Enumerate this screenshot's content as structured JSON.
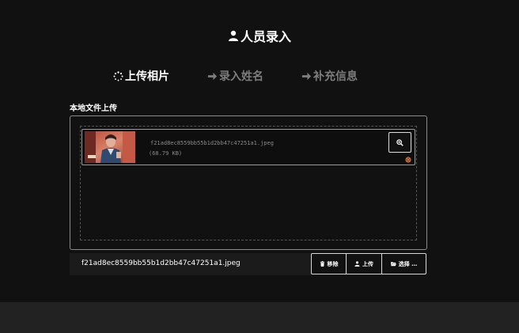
{
  "header": {
    "title": "人员录入",
    "title_icon": "user-icon"
  },
  "steps": [
    {
      "label": "上传相片",
      "icon": "spinner-icon",
      "active": true
    },
    {
      "label": "录入姓名",
      "icon": "arrow-right-icon",
      "active": false
    },
    {
      "label": "补充信息",
      "icon": "arrow-right-icon",
      "active": false
    }
  ],
  "upload": {
    "section_label": "本地文件上传",
    "file": {
      "name": "f21ad8ec8559bb55b1d2bb47c47251a1.jpeg",
      "size": "(68.79 KB)"
    },
    "caption": "f21ad8ec8559bb55b1d2bb47c47251a1.jpeg",
    "buttons": {
      "remove": "移除",
      "upload": "上传",
      "choose": "选择 …"
    }
  },
  "colors": {
    "background": "#111111",
    "footer": "#222222",
    "inactive_step": "#7d7d7d",
    "muted_text": "#8a8a8a",
    "drag_icon": "#c9703a"
  }
}
